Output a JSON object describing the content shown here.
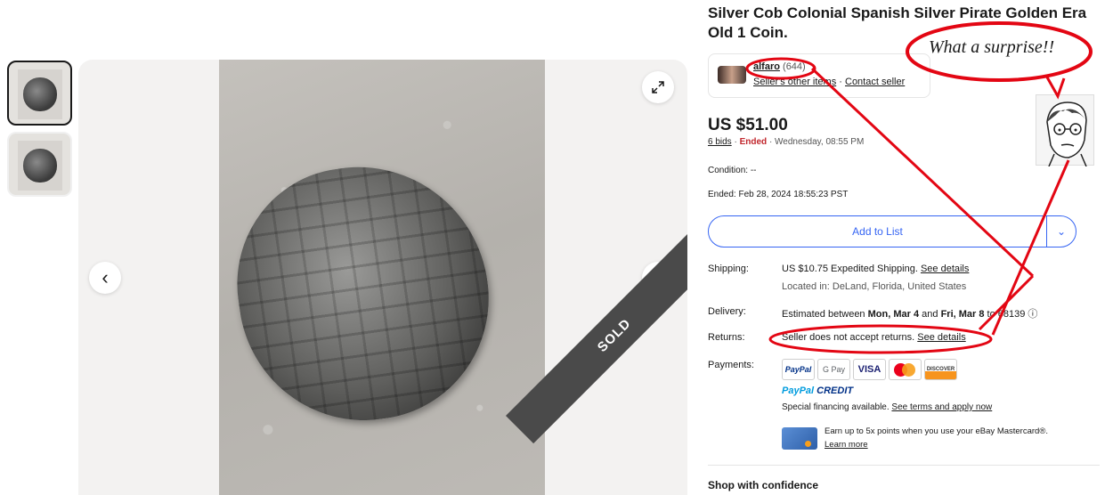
{
  "listing": {
    "title": "Silver Cob Colonial Spanish Silver Pirate Golden Era Old 1 Coin.",
    "sold_label": "SOLD"
  },
  "seller": {
    "name": "alfaro",
    "score": "(644)",
    "other_items": "Seller's other items",
    "separator": "·",
    "contact": "Contact seller"
  },
  "price": {
    "amount": "US $51.00",
    "bids": "6 bids",
    "sep": "·",
    "status": "Ended",
    "end_text": "· Wednesday, 08:55 PM"
  },
  "condition": {
    "label": "Condition:",
    "value": "--"
  },
  "ended": {
    "label": "Ended:",
    "value": "Feb 28, 2024 18:55:23 PST"
  },
  "actions": {
    "add_to_list": "Add to List",
    "dropdown": "⌄"
  },
  "shipping": {
    "label": "Shipping:",
    "value": "US $10.75 Expedited Shipping.",
    "link": "See details",
    "location": "Located in: DeLand, Florida, United States"
  },
  "delivery": {
    "label": "Delivery:",
    "prefix": "Estimated between",
    "start": "Mon, Mar 4",
    "and": "and",
    "end": "Fri, Mar 8",
    "to": "to 68139",
    "info_icon": "ⓘ"
  },
  "returns": {
    "label": "Returns:",
    "value": "Seller does not accept returns.",
    "link": "See details"
  },
  "payments": {
    "label": "Payments:",
    "methods": [
      "PayPal",
      "G Pay",
      "VISA",
      "mastercard",
      "DISCOVER"
    ],
    "credit_a": "PayPal",
    "credit_b": "CREDIT",
    "financing": "Special financing available.",
    "financing_link": "See terms and apply now",
    "earn": "Earn up to 5x points when you use your eBay Mastercard®.",
    "learn_more": "Learn more"
  },
  "shop_confidence": "Shop with confidence",
  "annotation": {
    "text": "What a surprise!!",
    "color": "#e30613"
  },
  "gallery": {
    "prev_icon": "‹",
    "next_icon": "›",
    "expand_icon": "⤢"
  }
}
